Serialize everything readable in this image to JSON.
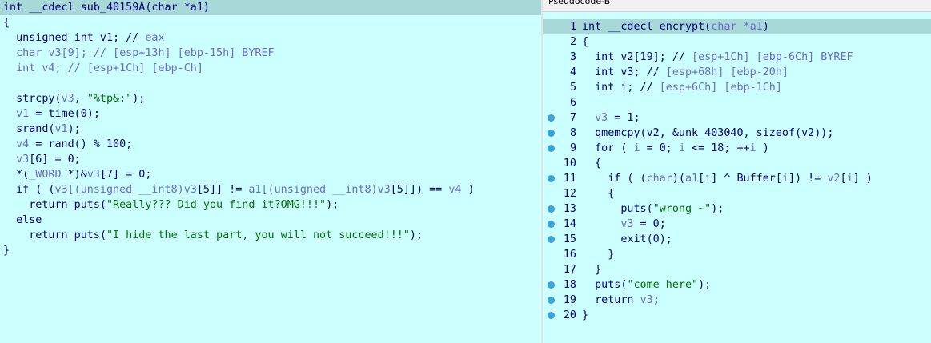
{
  "left_pane": {
    "lines": [
      [
        {
          "t": "int __cdecl sub_40159A(char *a1)",
          "c": "k"
        }
      ],
      [
        {
          "t": "{",
          "c": "p"
        }
      ],
      [
        {
          "t": "  unsigned int v1; // ",
          "c": "k"
        },
        {
          "t": "eax",
          "c": "c"
        }
      ],
      [
        {
          "t": "  char v3[9]; // [esp+13h] [ebp-15h] BYREF",
          "c": "c"
        }
      ],
      [
        {
          "t": "  int v4; // [esp+1Ch] [ebp-Ch]",
          "c": "c"
        }
      ],
      [
        {
          "t": "",
          "c": "p"
        }
      ],
      [
        {
          "t": "  strcpy(",
          "c": "k"
        },
        {
          "t": "v3",
          "c": "v"
        },
        {
          "t": ", ",
          "c": "k"
        },
        {
          "t": "\"%tp&:\"",
          "c": "s"
        },
        {
          "t": ");",
          "c": "k"
        }
      ],
      [
        {
          "t": "  v1",
          "c": "v"
        },
        {
          "t": " = time(0);",
          "c": "k"
        }
      ],
      [
        {
          "t": "  srand(",
          "c": "k"
        },
        {
          "t": "v1",
          "c": "v"
        },
        {
          "t": ");",
          "c": "k"
        }
      ],
      [
        {
          "t": "  v4",
          "c": "v"
        },
        {
          "t": " = rand() % 100;",
          "c": "k"
        }
      ],
      [
        {
          "t": "  v3",
          "c": "v"
        },
        {
          "t": "[6] = 0;",
          "c": "k"
        }
      ],
      [
        {
          "t": "  *(",
          "c": "k"
        },
        {
          "t": "_WORD",
          "c": "v"
        },
        {
          "t": " *)&",
          "c": "k"
        },
        {
          "t": "v3",
          "c": "v"
        },
        {
          "t": "[7] = 0;",
          "c": "k"
        }
      ],
      [
        {
          "t": "  if ( (",
          "c": "k"
        },
        {
          "t": "v3",
          "c": "v"
        },
        {
          "t": "[(unsigned __int8)",
          "c": "v"
        },
        {
          "t": "v3",
          "c": "v"
        },
        {
          "t": "[5]] != ",
          "c": "k"
        },
        {
          "t": "a1",
          "c": "v"
        },
        {
          "t": "[(unsigned __int8)",
          "c": "v"
        },
        {
          "t": "v3",
          "c": "v"
        },
        {
          "t": "[5]]) == ",
          "c": "k"
        },
        {
          "t": "v4",
          "c": "v"
        },
        {
          "t": " )",
          "c": "k"
        }
      ],
      [
        {
          "t": "    return puts(",
          "c": "k"
        },
        {
          "t": "\"Really??? Did you find it?OMG!!!\"",
          "c": "s"
        },
        {
          "t": ");",
          "c": "k"
        }
      ],
      [
        {
          "t": "  else",
          "c": "k"
        }
      ],
      [
        {
          "t": "    return puts(",
          "c": "k"
        },
        {
          "t": "\"I hide the last part, you will not succeed!!!\"",
          "c": "s"
        },
        {
          "t": ");",
          "c": "k"
        }
      ],
      [
        {
          "t": "}",
          "c": "p"
        }
      ]
    ]
  },
  "right_pane": {
    "tab_title": "Pseudocode-B",
    "lines": [
      {
        "n": "1",
        "bp": false,
        "seg": [
          {
            "t": "int __cdecl encrypt(",
            "c": "k"
          },
          {
            "t": "char *a1",
            "c": "v"
          },
          {
            "t": ")",
            "c": "k"
          }
        ]
      },
      {
        "n": "2",
        "bp": false,
        "seg": [
          {
            "t": "{",
            "c": "p"
          }
        ]
      },
      {
        "n": "3",
        "bp": false,
        "seg": [
          {
            "t": "  int v2[19]; // ",
            "c": "k"
          },
          {
            "t": "[esp+1Ch] [ebp-6Ch] BYREF",
            "c": "c"
          }
        ]
      },
      {
        "n": "4",
        "bp": false,
        "seg": [
          {
            "t": "  int v3; // ",
            "c": "k"
          },
          {
            "t": "[esp+68h] [ebp-20h]",
            "c": "c"
          }
        ]
      },
      {
        "n": "5",
        "bp": false,
        "seg": [
          {
            "t": "  int i; // ",
            "c": "k"
          },
          {
            "t": "[esp+6Ch] [ebp-1Ch]",
            "c": "c"
          }
        ]
      },
      {
        "n": "6",
        "bp": false,
        "seg": [
          {
            "t": "",
            "c": "p"
          }
        ]
      },
      {
        "n": "7",
        "bp": true,
        "seg": [
          {
            "t": "  v3",
            "c": "v"
          },
          {
            "t": " = 1;",
            "c": "k"
          }
        ]
      },
      {
        "n": "8",
        "bp": true,
        "seg": [
          {
            "t": "  qmemcpy(v2, &unk_403040, sizeof(v2));",
            "c": "k"
          }
        ]
      },
      {
        "n": "9",
        "bp": true,
        "seg": [
          {
            "t": "  for ( ",
            "c": "k"
          },
          {
            "t": "i",
            "c": "v"
          },
          {
            "t": " = 0; ",
            "c": "k"
          },
          {
            "t": "i",
            "c": "v"
          },
          {
            "t": " <= 18; ++",
            "c": "k"
          },
          {
            "t": "i",
            "c": "v"
          },
          {
            "t": " )",
            "c": "k"
          }
        ]
      },
      {
        "n": "10",
        "bp": false,
        "seg": [
          {
            "t": "  {",
            "c": "k"
          }
        ]
      },
      {
        "n": "11",
        "bp": true,
        "seg": [
          {
            "t": "    if ( (",
            "c": "k"
          },
          {
            "t": "char",
            "c": "v"
          },
          {
            "t": ")(",
            "c": "k"
          },
          {
            "t": "a1",
            "c": "v"
          },
          {
            "t": "[",
            "c": "k"
          },
          {
            "t": "i",
            "c": "v"
          },
          {
            "t": "] ^ Buffer[",
            "c": "k"
          },
          {
            "t": "i",
            "c": "v"
          },
          {
            "t": "]) != ",
            "c": "k"
          },
          {
            "t": "v2",
            "c": "v"
          },
          {
            "t": "[",
            "c": "k"
          },
          {
            "t": "i",
            "c": "v"
          },
          {
            "t": "] )",
            "c": "k"
          }
        ]
      },
      {
        "n": "12",
        "bp": false,
        "seg": [
          {
            "t": "    {",
            "c": "k"
          }
        ]
      },
      {
        "n": "13",
        "bp": true,
        "seg": [
          {
            "t": "      puts(",
            "c": "k"
          },
          {
            "t": "\"wrong ~\"",
            "c": "s"
          },
          {
            "t": ");",
            "c": "k"
          }
        ]
      },
      {
        "n": "14",
        "bp": true,
        "seg": [
          {
            "t": "      v3",
            "c": "v"
          },
          {
            "t": " = 0;",
            "c": "k"
          }
        ]
      },
      {
        "n": "15",
        "bp": true,
        "seg": [
          {
            "t": "      exit(0);",
            "c": "k"
          }
        ]
      },
      {
        "n": "16",
        "bp": false,
        "seg": [
          {
            "t": "    }",
            "c": "k"
          }
        ]
      },
      {
        "n": "17",
        "bp": false,
        "seg": [
          {
            "t": "  }",
            "c": "k"
          }
        ]
      },
      {
        "n": "18",
        "bp": true,
        "seg": [
          {
            "t": "  puts(",
            "c": "k"
          },
          {
            "t": "\"come here\"",
            "c": "s"
          },
          {
            "t": ");",
            "c": "k"
          }
        ]
      },
      {
        "n": "19",
        "bp": true,
        "seg": [
          {
            "t": "  return ",
            "c": "k"
          },
          {
            "t": "v3",
            "c": "v"
          },
          {
            "t": ";",
            "c": "k"
          }
        ]
      },
      {
        "n": "20",
        "bp": true,
        "seg": [
          {
            "t": "}",
            "c": "p"
          }
        ]
      }
    ]
  },
  "colors": {
    "background": "#ccffff",
    "current_line": "#a8d8d8",
    "keyword": "#000080",
    "variable": "#6a6acd",
    "string": "#007000",
    "breakpoint": "#3aa0e0"
  }
}
